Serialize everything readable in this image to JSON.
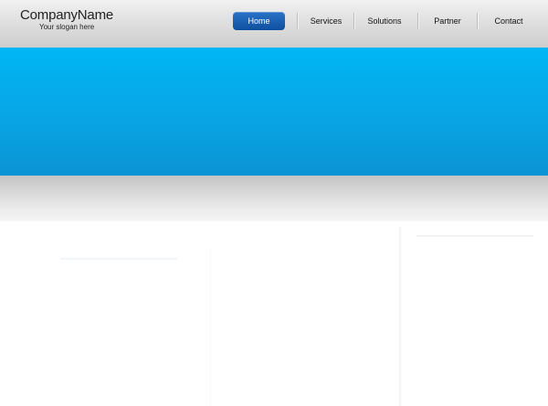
{
  "brand": {
    "company_name": "CompanyName",
    "slogan": "Your slogan here"
  },
  "nav": {
    "items": [
      {
        "label": "Home",
        "active": true
      },
      {
        "label": "Services",
        "active": false
      },
      {
        "label": "Solutions",
        "active": false
      },
      {
        "label": "Partner",
        "active": false
      },
      {
        "label": "Contact",
        "active": false
      }
    ]
  },
  "colors": {
    "banner": "#0aa6e6",
    "nav_active": "#1a5fb0",
    "header": "#dcdcdc"
  }
}
